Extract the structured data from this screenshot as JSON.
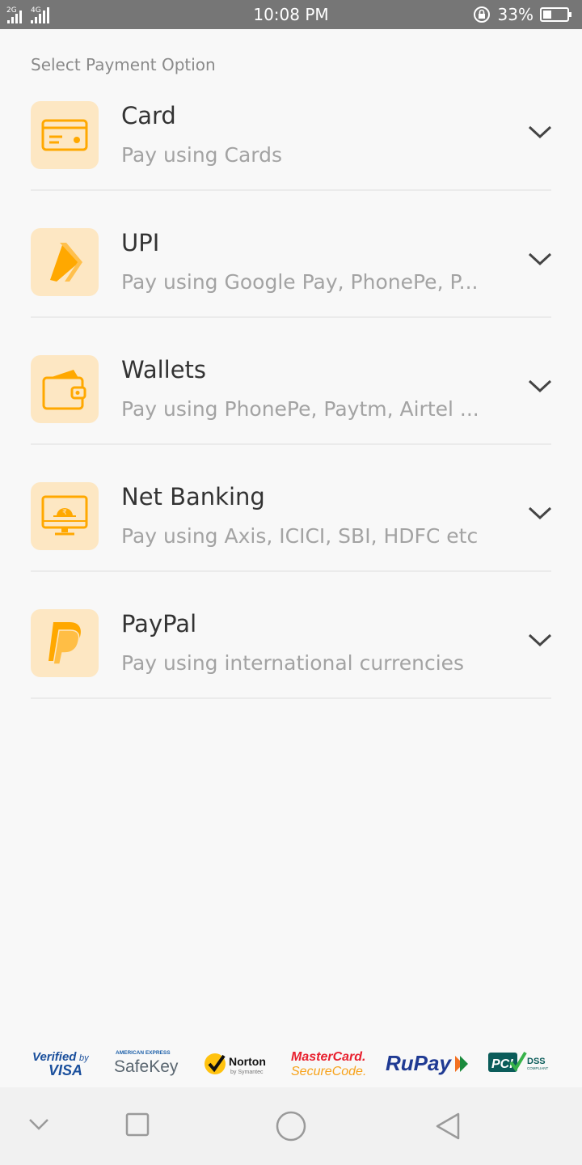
{
  "status_bar": {
    "network_1": "2G",
    "network_2": "4G",
    "time": "10:08 PM",
    "battery": "33%"
  },
  "page": {
    "section_title": "Select Payment Option"
  },
  "payment_options": [
    {
      "title": "Card",
      "subtitle": "Pay using Cards",
      "icon": "credit-card-icon"
    },
    {
      "title": "UPI",
      "subtitle": "Pay using Google Pay, PhonePe, P...",
      "icon": "upi-icon"
    },
    {
      "title": "Wallets",
      "subtitle": "Pay using PhonePe, Paytm, Airtel ...",
      "icon": "wallet-icon"
    },
    {
      "title": "Net Banking",
      "subtitle": "Pay using Axis, ICICI, SBI, HDFC etc",
      "icon": "net-banking-icon"
    },
    {
      "title": "PayPal",
      "subtitle": "Pay using international currencies",
      "icon": "paypal-icon"
    }
  ],
  "trust_logos": [
    {
      "name": "Verified by VISA"
    },
    {
      "name": "American Express SafeKey"
    },
    {
      "name": "Norton by Symantec"
    },
    {
      "name": "MasterCard SecureCode"
    },
    {
      "name": "RuPay"
    },
    {
      "name": "PCI DSS Compliant"
    }
  ],
  "colors": {
    "accent": "#ffa800",
    "icon_bg": "#fde7c3",
    "status_bar": "#767676",
    "title_text": "#333333",
    "subtitle_text": "#a3a3a3"
  }
}
